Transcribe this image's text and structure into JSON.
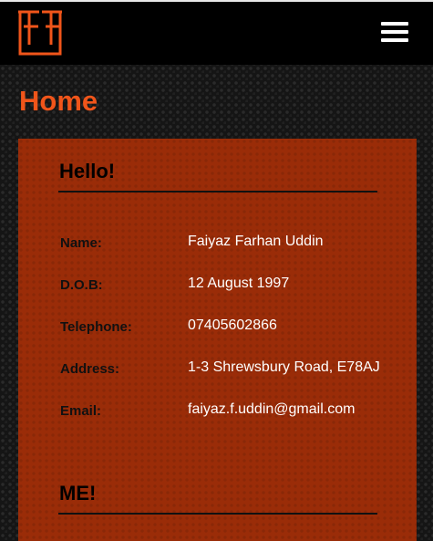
{
  "header": {
    "logo_name": "ff-logo",
    "menu_icon": "hamburger-menu-icon"
  },
  "page": {
    "title": "Home"
  },
  "card": {
    "greeting": "Hello!",
    "rows": [
      {
        "label": "Name:",
        "value": "Faiyaz Farhan Uddin"
      },
      {
        "label": "D.O.B:",
        "value": "12 August 1997"
      },
      {
        "label": "Telephone:",
        "value": "07405602866"
      },
      {
        "label": "Address:",
        "value": "1-3 Shrewsbury Road, E78AJ"
      },
      {
        "label": "Email:",
        "value": "faiyaz.f.uddin@gmail.com"
      }
    ],
    "second_heading": "ME!"
  },
  "colors": {
    "accent": "#f0551a",
    "card_background": "#9a2c08",
    "navbar": "#000000"
  }
}
